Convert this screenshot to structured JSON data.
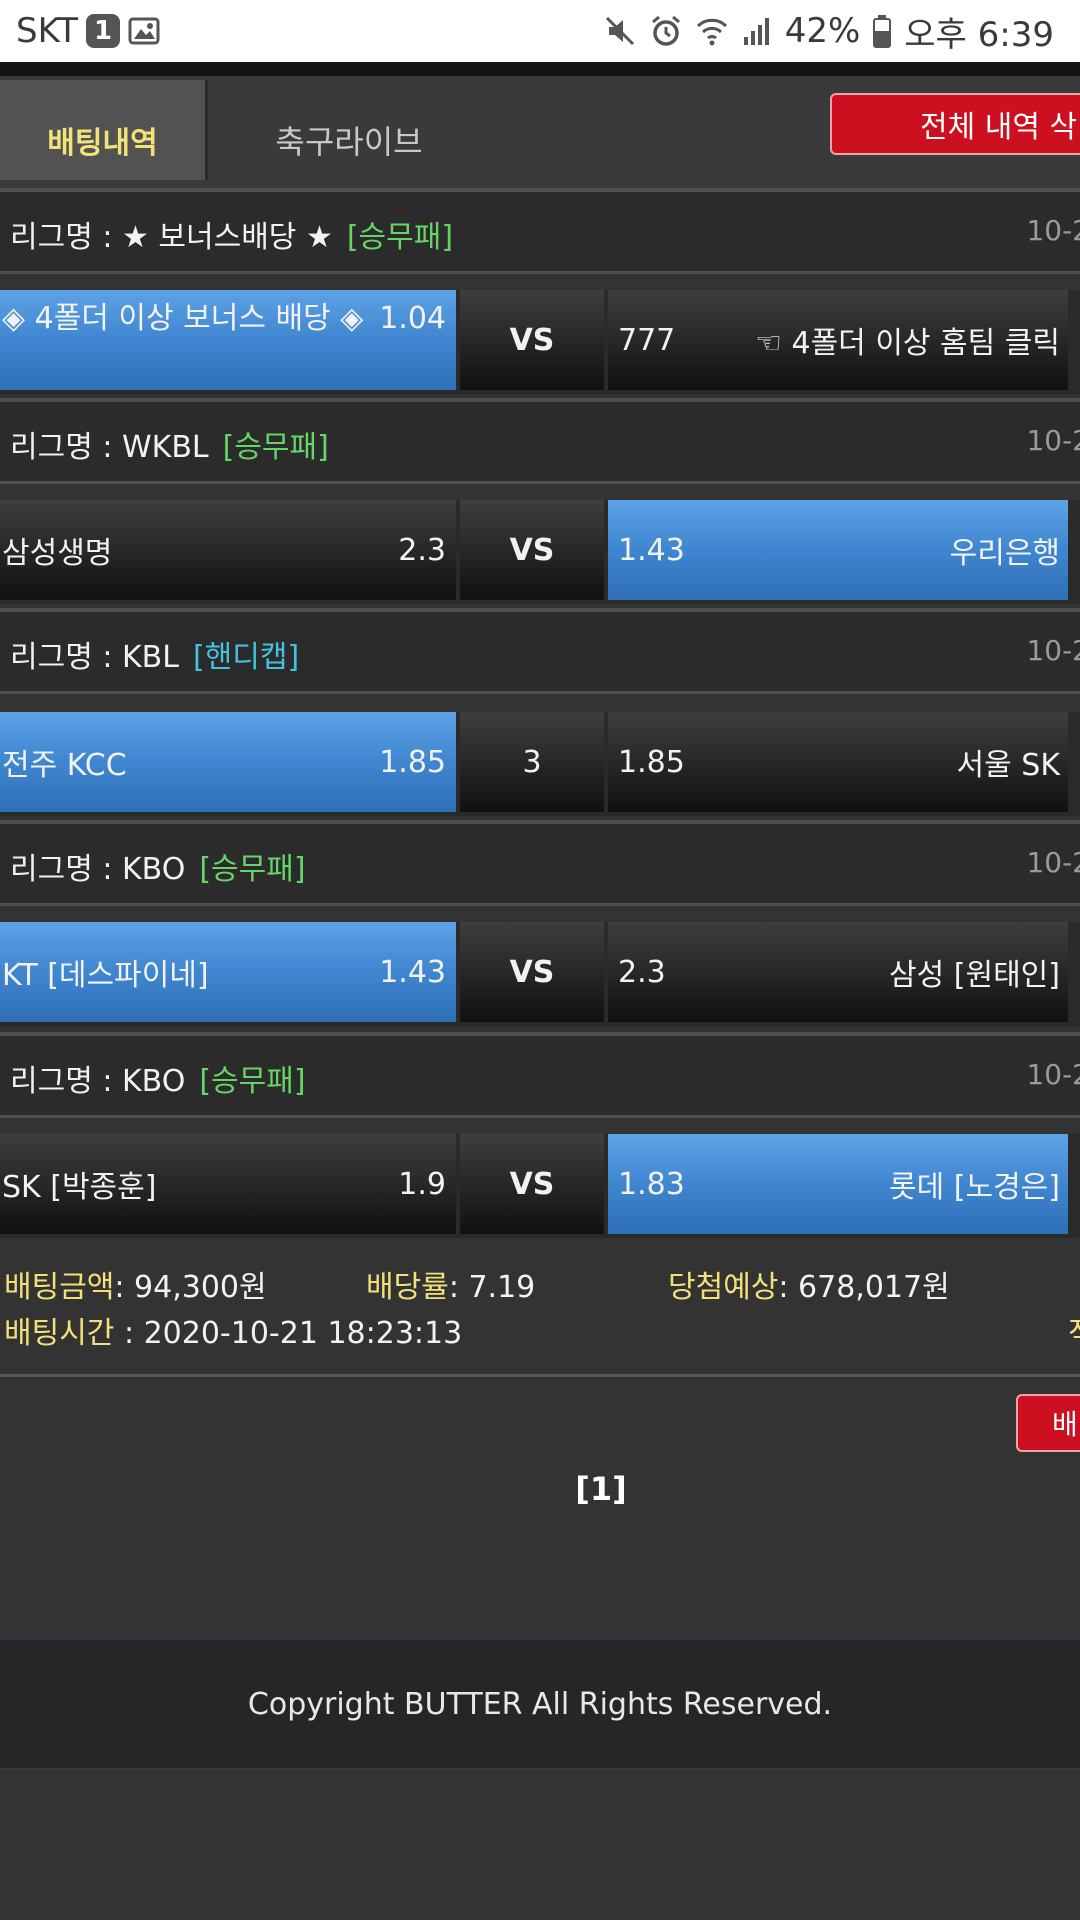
{
  "status_bar": {
    "carrier": "SKT",
    "sim_badge": "1",
    "battery": "42%",
    "time": "오후 6:39"
  },
  "tabs": [
    {
      "label": "배팅내역",
      "active": true
    },
    {
      "label": "축구라이브",
      "active": false
    }
  ],
  "delete_all_label": "전체 내역 삭",
  "matches": [
    {
      "league_label": "리그명 : ★ 보너스배당 ★",
      "type": "[승무패]",
      "type_color": "green",
      "date": "10-2",
      "home": "◈ 4폴더 이상 보너스 배당 ◈",
      "home_odds": "1.04",
      "mid": "VS",
      "away_odds": "777",
      "away": "☜ 4폴더 이상 홈팀 클릭",
      "selected": "home"
    },
    {
      "league_label": "리그명 : WKBL",
      "type": "[승무패]",
      "type_color": "green",
      "date": "10-2",
      "home": "삼성생명",
      "home_odds": "2.3",
      "mid": "VS",
      "away_odds": "1.43",
      "away": "우리은행",
      "selected": "away"
    },
    {
      "league_label": "리그명 : KBL",
      "type": "[핸디캡]",
      "type_color": "cyan",
      "date": "10-2",
      "home": "전주 KCC",
      "home_odds": "1.85",
      "mid": "3",
      "away_odds": "1.85",
      "away": "서울 SK",
      "selected": "home"
    },
    {
      "league_label": "리그명 : KBO",
      "type": "[승무패]",
      "type_color": "green",
      "date": "10-2",
      "home": "KT [데스파이네]",
      "home_odds": "1.43",
      "mid": "VS",
      "away_odds": "2.3",
      "away": "삼성 [원태인]",
      "selected": "home"
    },
    {
      "league_label": "리그명 : KBO",
      "type": "[승무패]",
      "type_color": "green",
      "date": "10-2",
      "home": "SK [박종훈]",
      "home_odds": "1.9",
      "mid": "VS",
      "away_odds": "1.83",
      "away": "롯데 [노경은]",
      "selected": "away"
    }
  ],
  "summary": {
    "bet_amount_label": "배팅금액",
    "bet_amount": ": 94,300원",
    "odds_label": "배당률",
    "odds": ": 7.19",
    "expected_label": "당첨예상",
    "expected": ": 678,017원",
    "bet_time_label": "배팅시간",
    "bet_time": " : 2020-10-21 18:23:13",
    "cut_text": "적"
  },
  "bet_button_label": "배팅",
  "pagination": "[1]",
  "footer": "Copyright BUTTER All Rights Reserved.",
  "colors": {
    "accent_red": "#cc1020",
    "selected_blue": "#3f86d0",
    "tab_active_text": "#f1e27a",
    "type_green": "#66d466",
    "type_cyan": "#43c2dc"
  }
}
